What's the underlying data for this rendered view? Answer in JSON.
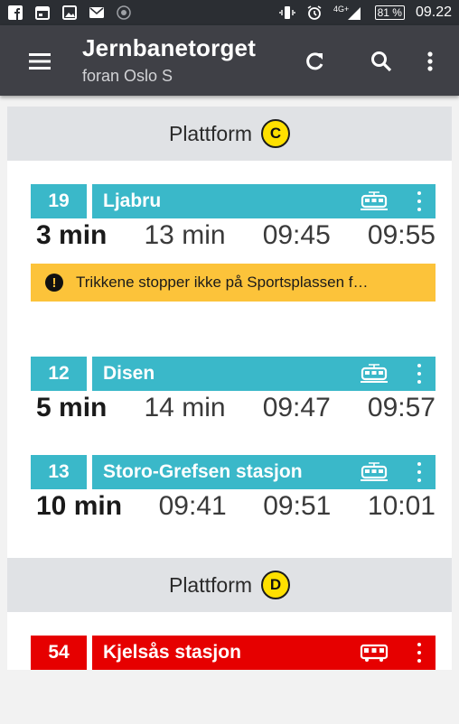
{
  "status_bar": {
    "icons_left": [
      "facebook-icon",
      "calendar-icon",
      "image-icon",
      "mail-icon",
      "radio-icon"
    ],
    "icons_right": [
      "vibrate-icon",
      "alarm-icon",
      "signal-4g-icon"
    ],
    "network": "4G⁺",
    "battery": "81 %",
    "time": "09.22"
  },
  "toolbar": {
    "title": "Jernbanetorget",
    "subtitle": "foran Oslo S",
    "actions": [
      "refresh-icon",
      "search-icon",
      "more-vert-icon"
    ]
  },
  "platforms": [
    {
      "label": "Plattform",
      "letter": "C",
      "departures": [
        {
          "line": "19",
          "destination": "Ljabru",
          "mode": "tram",
          "color": "#3ab8c9",
          "times": [
            "3 min",
            "13 min",
            "09:45",
            "09:55"
          ],
          "alert": "Trikkene stopper ikke på Sportsplassen f…"
        },
        {
          "line": "12",
          "destination": "Disen",
          "mode": "tram",
          "color": "#3ab8c9",
          "times": [
            "5 min",
            "14 min",
            "09:47",
            "09:57"
          ]
        },
        {
          "line": "13",
          "destination": "Storo-Grefsen stasjon",
          "mode": "tram",
          "color": "#3ab8c9",
          "times": [
            "10 min",
            "09:41",
            "09:51",
            "10:01"
          ]
        }
      ]
    },
    {
      "label": "Plattform",
      "letter": "D",
      "departures": [
        {
          "line": "54",
          "destination": "Kjelsås stasjon",
          "mode": "bus",
          "color": "#e60000"
        }
      ]
    }
  ]
}
